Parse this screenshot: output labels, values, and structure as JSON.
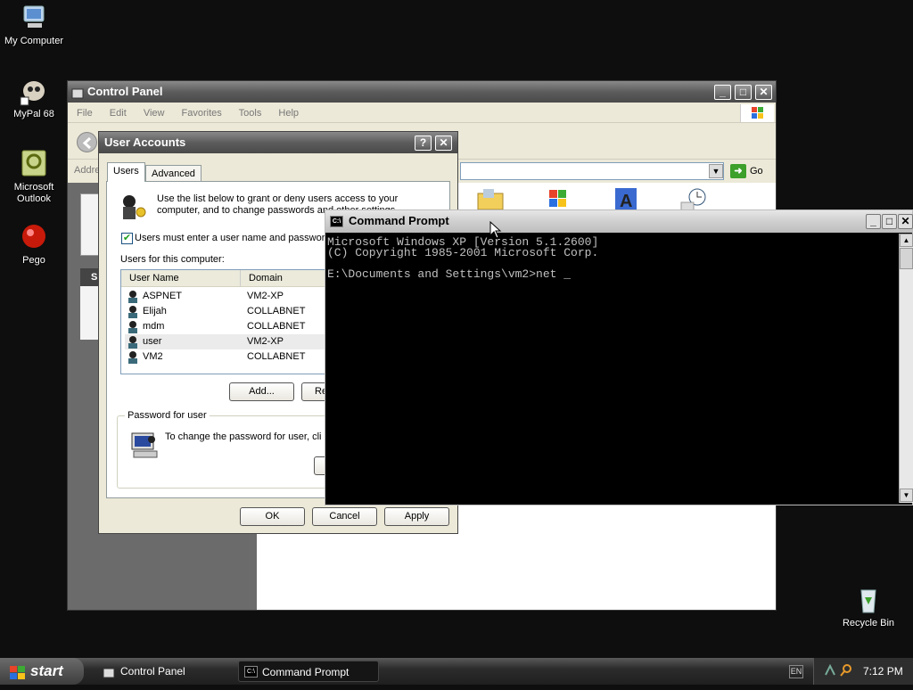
{
  "desktop": {
    "icons": [
      {
        "label": "My Computer",
        "icon": "my-computer-icon"
      },
      {
        "label": "MyPal 68",
        "icon": "mypal-icon"
      },
      {
        "label": "Microsoft Outlook",
        "icon": "outlook-icon"
      },
      {
        "label": "Pego",
        "icon": "pego-icon"
      },
      {
        "label": "Recycle Bin",
        "icon": "recycle-bin-icon"
      }
    ]
  },
  "control_panel": {
    "title": "Control Panel",
    "menu": [
      "File",
      "Edit",
      "View",
      "Favorites",
      "Tools",
      "Help"
    ],
    "address_label": "Addre",
    "go_label": "Go",
    "side_letter": "S"
  },
  "user_accounts": {
    "title": "User Accounts",
    "tabs": [
      "Users",
      "Advanced"
    ],
    "intro_line1": "Use the list below to grant or deny users access to your",
    "intro_line2": "computer, and to change passwords and other settings.",
    "checkbox_label": "Users must enter a user name and password to use this computer.",
    "users_label": "Users for this computer:",
    "columns": [
      "User Name",
      "Domain"
    ],
    "rows": [
      {
        "name": "ASPNET",
        "domain": "VM2-XP"
      },
      {
        "name": "Elijah",
        "domain": "COLLABNET"
      },
      {
        "name": "mdm",
        "domain": "COLLABNET"
      },
      {
        "name": "user",
        "domain": "VM2-XP"
      },
      {
        "name": "VM2",
        "domain": "COLLABNET"
      }
    ],
    "add_button": "Add...",
    "remove_button": "Re",
    "password_group": "Password for user",
    "password_text": "To change the password for user, cli",
    "ok": "OK",
    "cancel": "Cancel",
    "apply": "Apply"
  },
  "command_prompt": {
    "title": "Command Prompt",
    "lines": [
      "Microsoft Windows XP [Version 5.1.2600]",
      "(C) Copyright 1985-2001 Microsoft Corp.",
      "",
      "E:\\Documents and Settings\\vm2>net _"
    ]
  },
  "taskbar": {
    "start": "start",
    "tasks": [
      "Control Panel",
      "Command Prompt"
    ],
    "lang": "EN",
    "clock": "7:12 PM"
  },
  "colors": {
    "desktop": "#0e0e0e",
    "titlebar": "#5c5c5c",
    "cmd_bg": "#000000",
    "cmd_fg": "#c0c0c0"
  }
}
